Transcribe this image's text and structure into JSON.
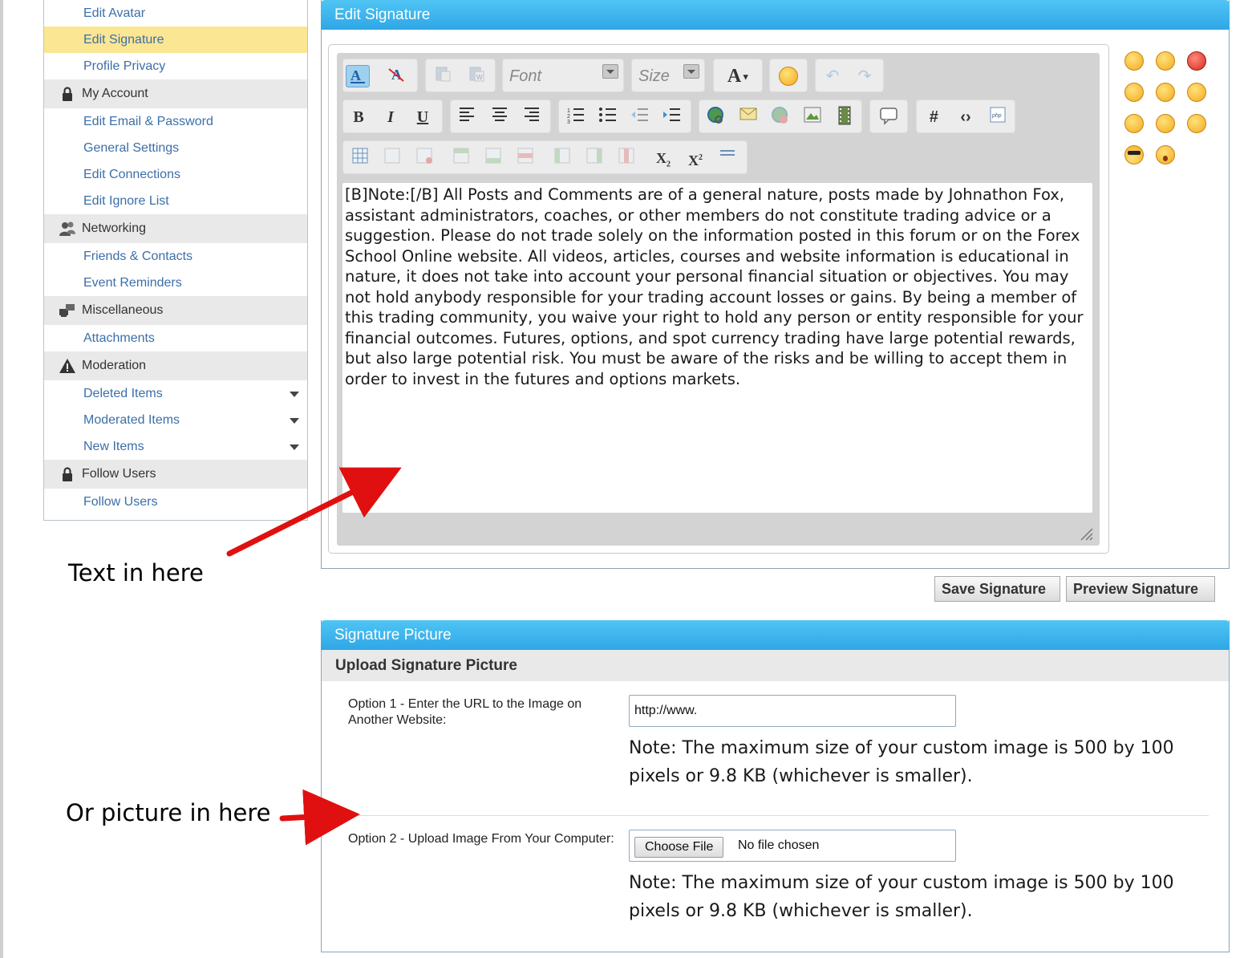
{
  "sidebar": {
    "items": [
      {
        "type": "item",
        "label": "Edit Avatar"
      },
      {
        "type": "item",
        "label": "Edit Signature",
        "active": true
      },
      {
        "type": "item",
        "label": "Profile Privacy"
      },
      {
        "type": "head",
        "label": "My Account",
        "icon": "lock-icon"
      },
      {
        "type": "item",
        "label": "Edit Email & Password"
      },
      {
        "type": "item",
        "label": "General Settings"
      },
      {
        "type": "item",
        "label": "Edit Connections"
      },
      {
        "type": "item",
        "label": "Edit Ignore List"
      },
      {
        "type": "head",
        "label": "Networking",
        "icon": "users-icon"
      },
      {
        "type": "item",
        "label": "Friends & Contacts"
      },
      {
        "type": "item",
        "label": "Event Reminders"
      },
      {
        "type": "head",
        "label": "Miscellaneous",
        "icon": "computers-icon"
      },
      {
        "type": "item",
        "label": "Attachments"
      },
      {
        "type": "head",
        "label": "Moderation",
        "icon": "warning-icon"
      },
      {
        "type": "item",
        "label": "Deleted Items",
        "caret": true
      },
      {
        "type": "item",
        "label": "Moderated Items",
        "caret": true
      },
      {
        "type": "item",
        "label": "New Items",
        "caret": true
      },
      {
        "type": "head",
        "label": "Follow Users",
        "icon": "lock-icon"
      },
      {
        "type": "item",
        "label": "Follow Users"
      }
    ]
  },
  "edit_signature": {
    "title": "Edit Signature",
    "font_placeholder": "Font",
    "size_placeholder": "Size",
    "text": "[B]Note:[/B] All Posts and Comments are of a general nature, posts made by Johnathon Fox, assistant administrators, coaches, or other members do not constitute trading advice or a suggestion. Please do not trade solely on the information posted in this forum or on the Forex School Online website. All videos, articles, courses and website information is educational in nature, it does not take into account your personal financial situation or objectives. You may not hold anybody responsible for your trading account losses or gains. By being a member of this trading community, you waive your right to hold any person or entity responsible for your financial outcomes.  Futures, options, and spot currency trading have large potential rewards, but also large potential risk. You must be aware of the risks and be willing to accept them in order to invest in the futures and options markets."
  },
  "buttons": {
    "save": "Save Signature",
    "preview": "Preview Signature"
  },
  "signature_picture": {
    "title": "Signature Picture",
    "subtitle": "Upload Signature Picture",
    "option1_label": "Option 1 - Enter the URL to the Image on Another Website:",
    "url_value": "http://www.",
    "option2_label": "Option 2 - Upload Image From Your Computer:",
    "choose_file": "Choose File",
    "no_file": "No file chosen",
    "note": "Note: The maximum size of your custom image is 500 by 100 pixels or 9.8 KB (whichever is smaller)."
  },
  "annotations": {
    "text_here": "Text in here",
    "picture_here": "Or picture in here"
  },
  "colors": {
    "header_blue": "#2fa7e6",
    "link_blue": "#3b6fa8",
    "active_yellow": "#fbe693",
    "arrow_red": "#e01010"
  }
}
